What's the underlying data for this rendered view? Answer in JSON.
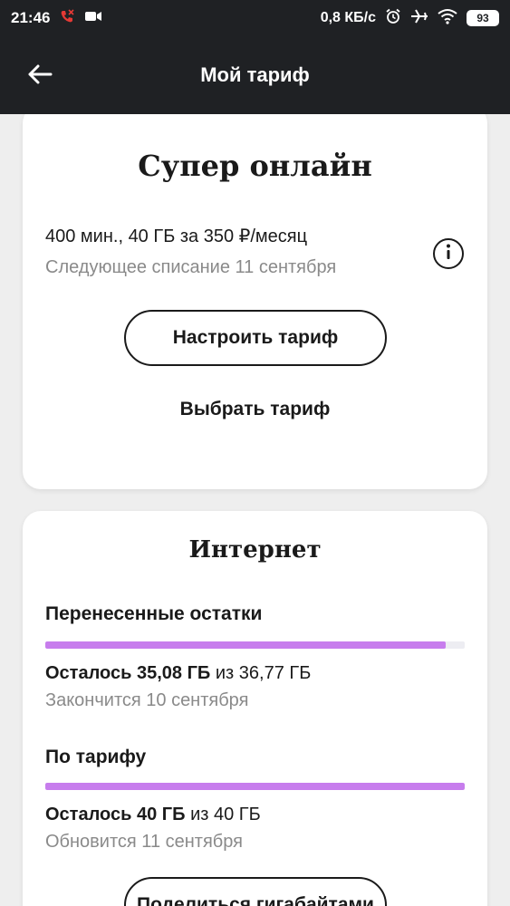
{
  "status_bar": {
    "time": "21:46",
    "speed": "0,8 КБ/с",
    "battery": "93",
    "icons": [
      "missed-call-icon",
      "video-icon",
      "alarm-icon",
      "airplane-icon",
      "wifi-icon",
      "battery-icon"
    ]
  },
  "app_bar": {
    "title": "Мой тариф",
    "back_icon": "arrow-left-icon"
  },
  "tariff_card": {
    "name": "Супер онлайн",
    "description": "400 мин., 40 ГБ за 350 ₽/месяц",
    "next_charge": "Следующее списание 11 сентября",
    "info_icon": "info-icon",
    "setup_button": "Настроить тариф",
    "choose_button": "Выбрать тариф"
  },
  "internet_card": {
    "title": "Интернет",
    "carried_over": {
      "heading": "Перенесенные остатки",
      "remaining_prefix": "Осталось",
      "remaining_value": "35,08 ГБ",
      "total": "из 36,77 ГБ",
      "fraction_remaining": 0.954,
      "expires": "Закончится 10 сентября"
    },
    "by_tariff": {
      "heading": "По тарифу",
      "remaining_prefix": "Осталось",
      "remaining_value": "40 ГБ",
      "total": "из 40 ГБ",
      "fraction_remaining": 1.0,
      "renews": "Обновится 11 сентября"
    },
    "share_button": "Поделиться гигабайтами"
  },
  "colors": {
    "header_bg": "#1f2124",
    "progress_fill": "#c77ded",
    "progress_track": "#ededf2",
    "muted_text": "#8a8a8a"
  }
}
